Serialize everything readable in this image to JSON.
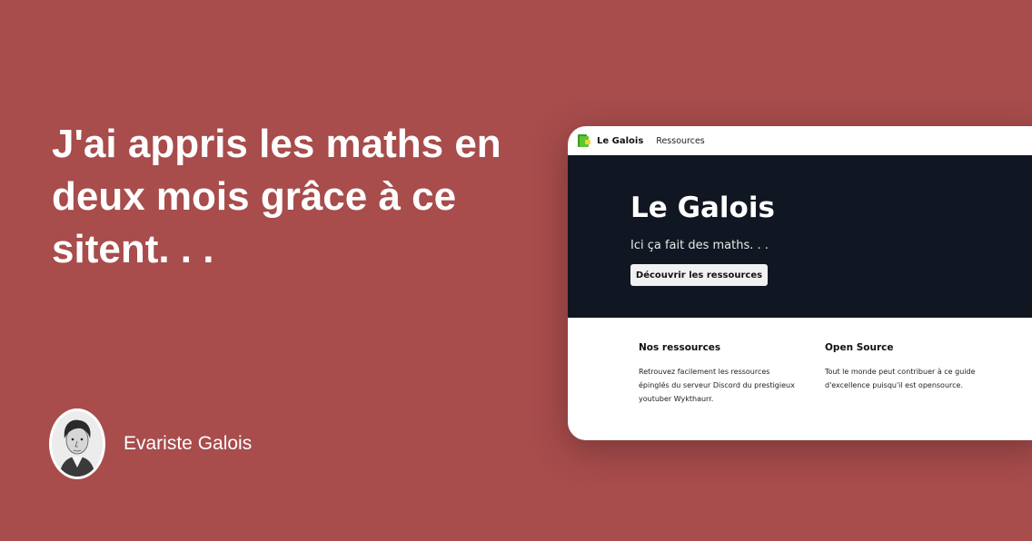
{
  "quote": {
    "text": "J'ai appris les maths en deux mois grâce à ce sitent. . ."
  },
  "author": {
    "name": "Evariste Galois"
  },
  "site": {
    "nav": {
      "brand": "Le Galois",
      "link": "Ressources"
    },
    "hero": {
      "title": "Le Galois",
      "subtitle": "Ici ça fait des maths. . .",
      "button": "Découvrir les ressources"
    },
    "features": [
      {
        "title": "Nos ressources",
        "body": "Retrouvez facilement les ressources épinglés du serveur Discord du prestigieux youtuber Wykthaurr."
      },
      {
        "title": "Open Source",
        "body": "Tout le monde peut contribuer à ce guide d'excellence puisqu'il est opensource."
      }
    ]
  },
  "colors": {
    "background": "#a84c4c",
    "hero_background": "#111722",
    "logo_green": "#4caf2a"
  },
  "icons": {
    "logo": "green-book-logo-icon",
    "avatar": "portrait-avatar"
  }
}
